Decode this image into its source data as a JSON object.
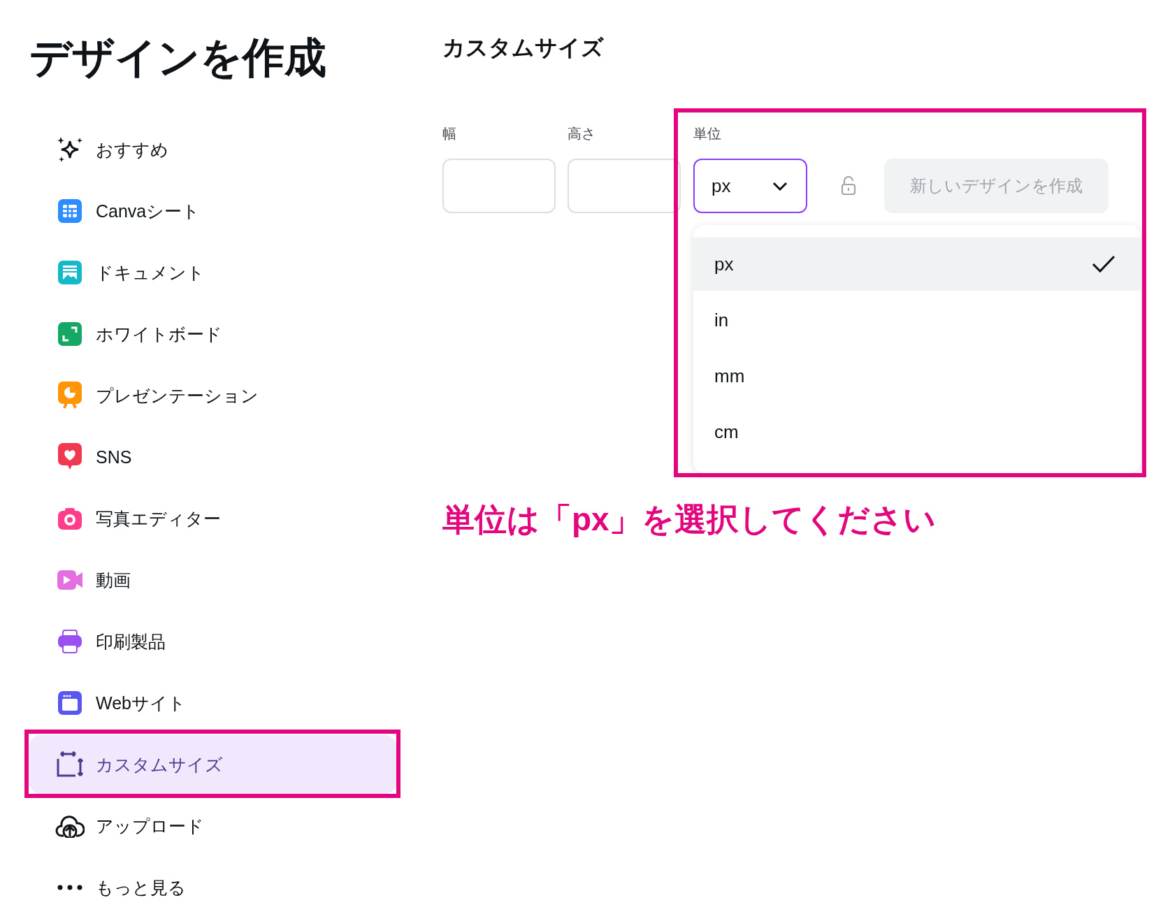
{
  "title": "デザインを作成",
  "sidebar": {
    "items": [
      {
        "label": "おすすめ",
        "kind": "sparkle",
        "selected": false
      },
      {
        "label": "Canvaシート",
        "kind": "sheet",
        "selected": false
      },
      {
        "label": "ドキュメント",
        "kind": "doc",
        "selected": false
      },
      {
        "label": "ホワイトボード",
        "kind": "whiteboard",
        "selected": false
      },
      {
        "label": "プレゼンテーション",
        "kind": "presentation",
        "selected": false
      },
      {
        "label": "SNS",
        "kind": "social",
        "selected": false
      },
      {
        "label": "写真エディター",
        "kind": "camera",
        "selected": false
      },
      {
        "label": "動画",
        "kind": "video",
        "selected": false
      },
      {
        "label": "印刷製品",
        "kind": "print",
        "selected": false
      },
      {
        "label": "Webサイト",
        "kind": "web",
        "selected": false
      },
      {
        "label": "カスタムサイズ",
        "kind": "resize",
        "selected": true
      },
      {
        "label": "アップロード",
        "kind": "upload",
        "selected": false
      },
      {
        "label": "もっと見る",
        "kind": "more",
        "selected": false
      }
    ]
  },
  "custom_size": {
    "heading": "カスタムサイズ",
    "fields": [
      {
        "label": "幅"
      },
      {
        "label": "高さ"
      }
    ],
    "unit": {
      "label": "単位",
      "value": "px",
      "expanded": true,
      "options": [
        {
          "label": "px",
          "selected": true
        },
        {
          "label": "in",
          "selected": false
        },
        {
          "label": "mm",
          "selected": false
        },
        {
          "label": "cm",
          "selected": false
        }
      ]
    },
    "create_button": {
      "label": "新しいデザインを作成",
      "disabled": true
    }
  },
  "annotation": {
    "text": "単位は「px」を選択してください"
  }
}
